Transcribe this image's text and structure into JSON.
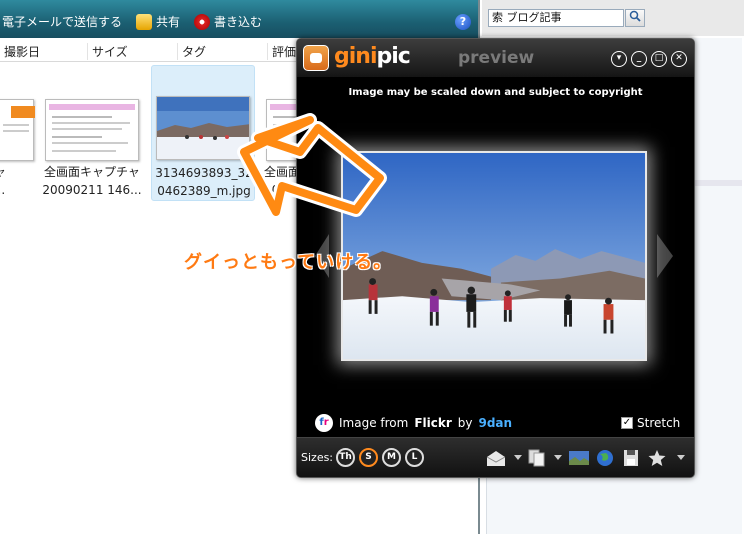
{
  "explorer": {
    "toolbar": {
      "email_label": "電子メールで送信する",
      "share_label": "共有",
      "burn_label": "書き込む",
      "help_label": "?"
    },
    "columns": [
      "撮影日",
      "サイズ",
      "タグ",
      "評価"
    ],
    "files": [
      {
        "line1": "プチャ",
        "line2": "212...",
        "selected": false
      },
      {
        "line1": "全画面キャプチャ",
        "line2": "20090211 146...",
        "selected": false
      },
      {
        "line1": "3134693893_3‌2",
        "line2": "0462389_m.jpg",
        "selected": true
      },
      {
        "line1": "全画面",
        "line2": "2009",
        "selected": false
      }
    ]
  },
  "right_panel": {
    "search_value": "索 ブログ記事",
    "search_icon": "search-icon"
  },
  "ginipic": {
    "logo_part1": "gini",
    "logo_part2": "pic",
    "mode": "preview",
    "notice": "Image may be scaled down and subject to copyright",
    "source_prefix": "Image from",
    "source_name": "Flickr",
    "source_by": "by",
    "source_user": "9dan",
    "stretch_label": "Stretch",
    "stretch_checked": true,
    "sizes_label": "Sizes:",
    "sizes": [
      "Th",
      "S",
      "M",
      "L"
    ],
    "active_size": "S",
    "accent_color": "#ff8a1e"
  },
  "annotation": {
    "text": "グイっともっていける。",
    "color": "#ff7a12"
  }
}
